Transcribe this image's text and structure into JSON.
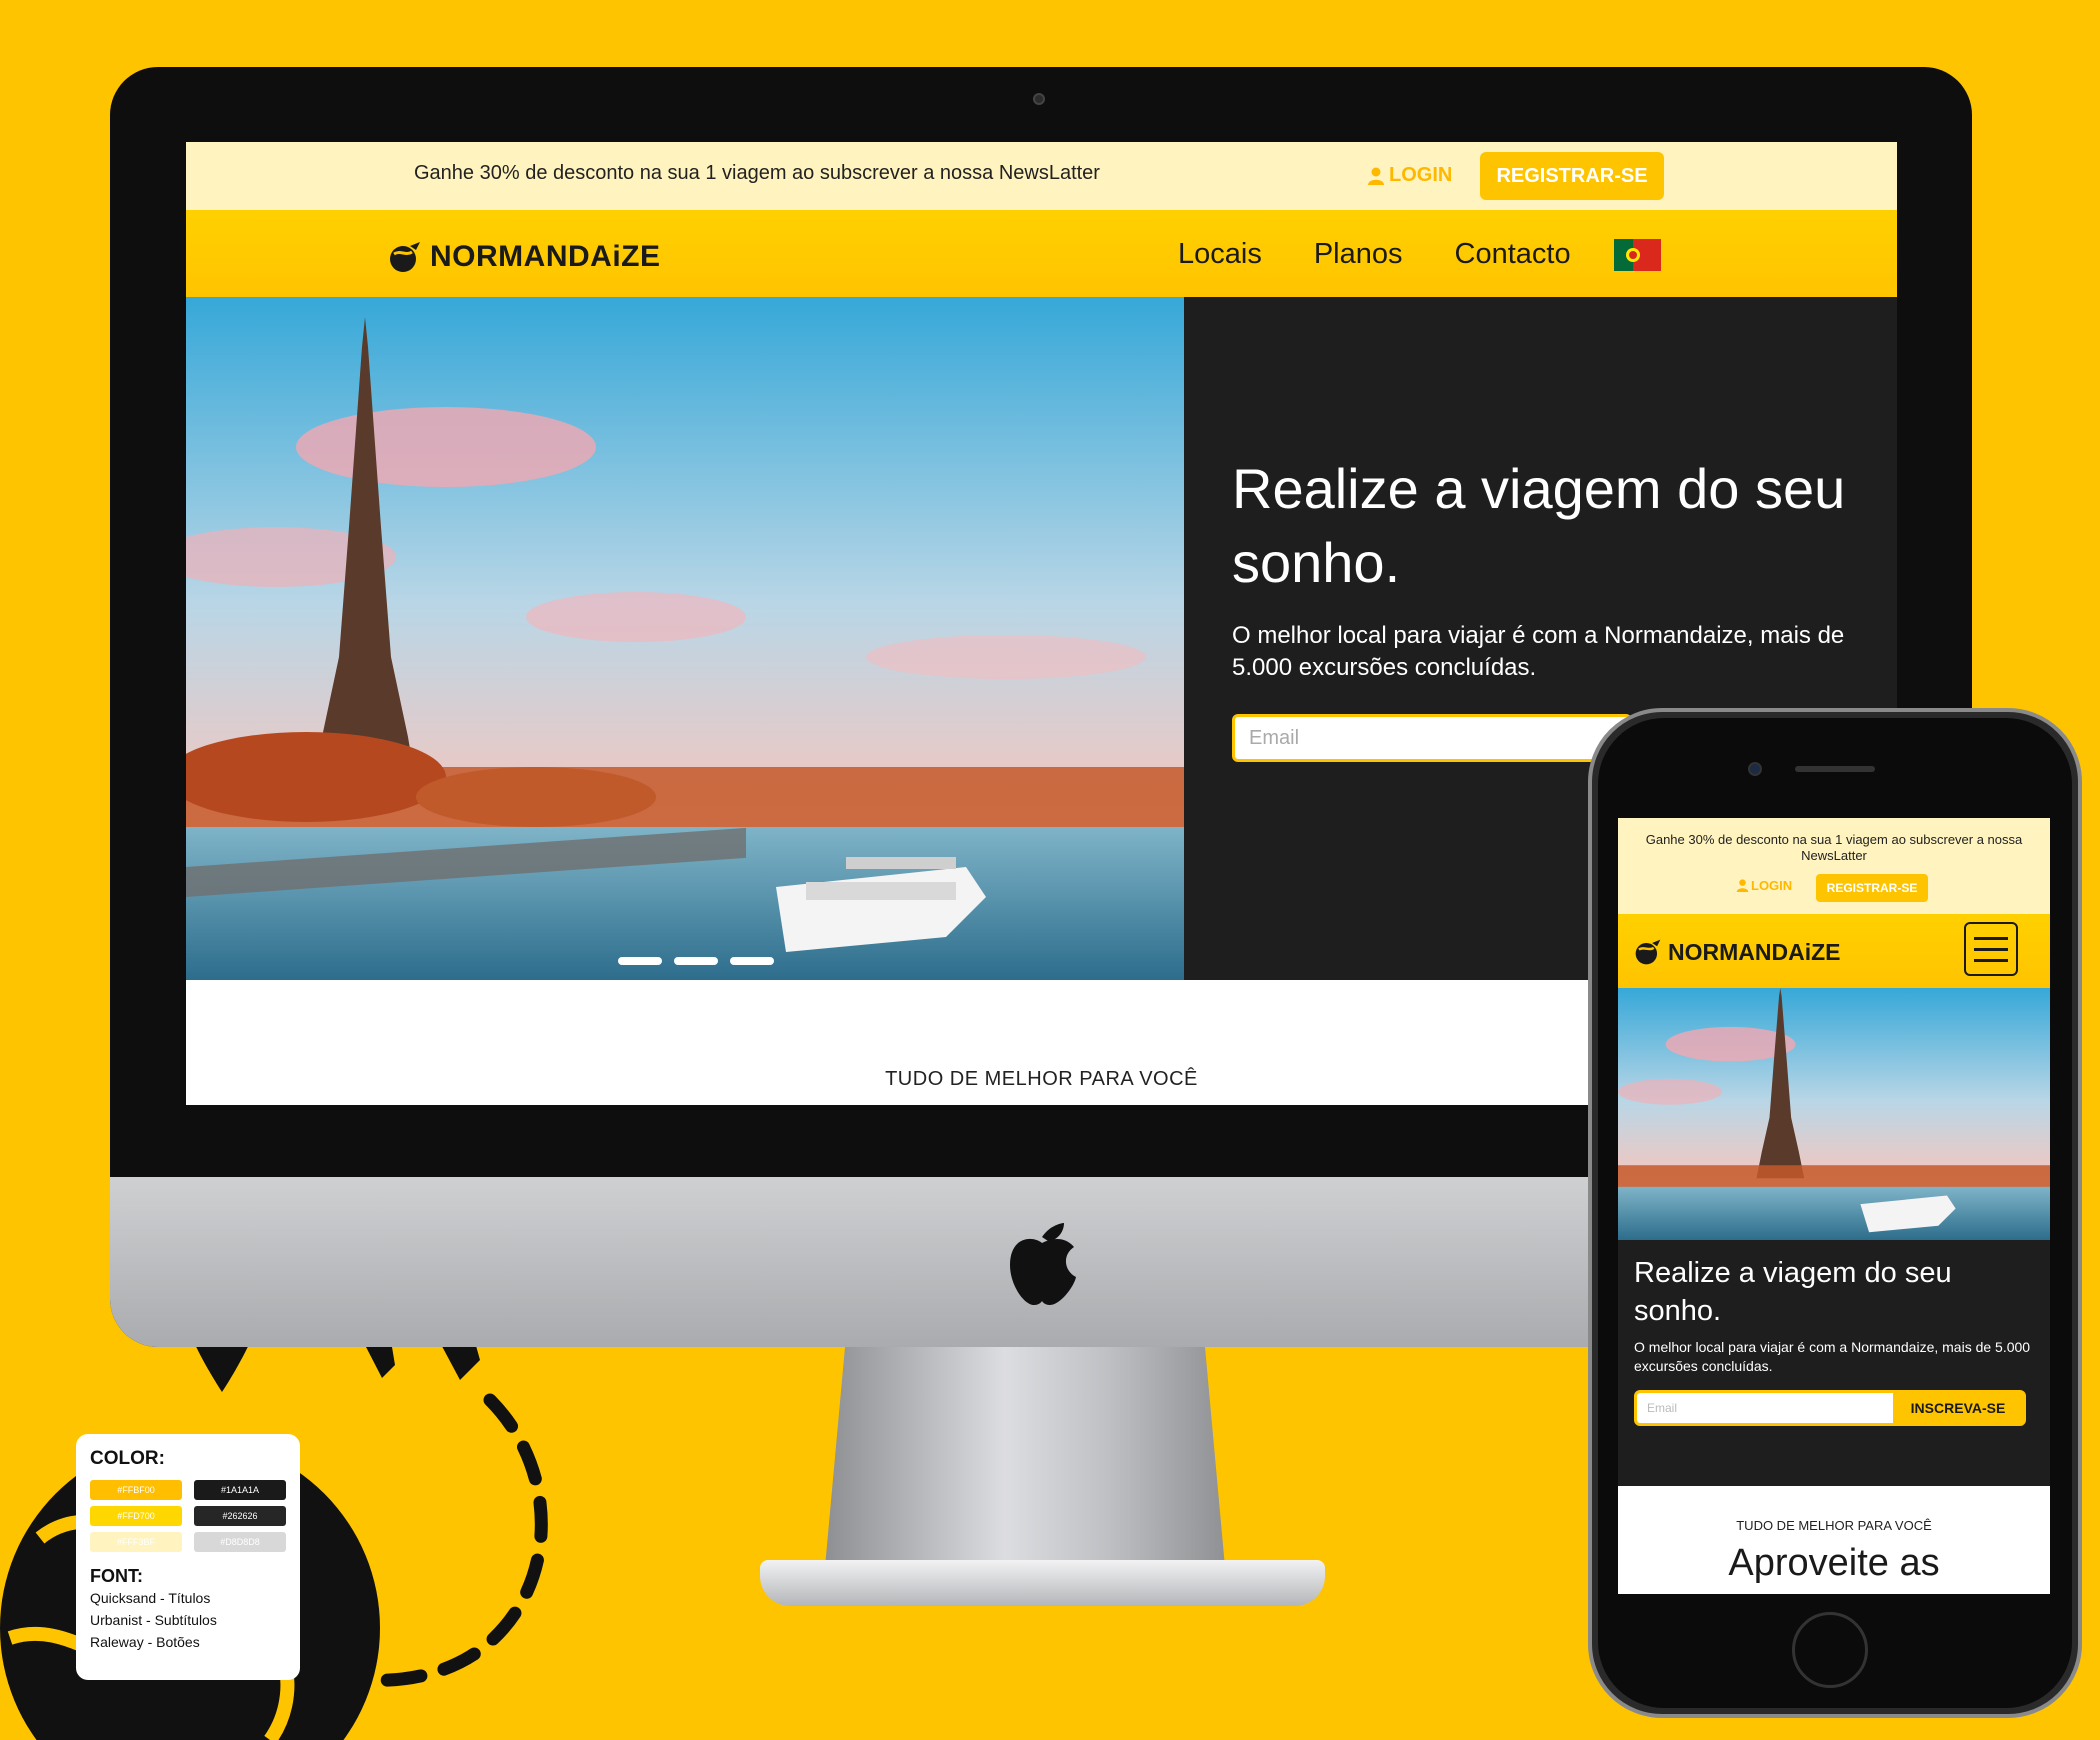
{
  "promo_text": "Ganhe 30% de desconto na sua 1 viagem ao subscrever a nossa NewsLatter",
  "auth": {
    "login_label": "LOGIN",
    "register_label": "REGISTRAR-SE"
  },
  "brand": {
    "name": "NORMANDAiZE"
  },
  "nav": {
    "links": [
      "Locais",
      "Planos",
      "Contacto"
    ]
  },
  "hero": {
    "title": "Realize a viagem do seu sonho.",
    "subtitle": "O melhor local para viajar é com a Normandaize, mais de 5.000 excursões concluídas.",
    "email_placeholder": "Email",
    "subscribe_label": "INSCREVA-SE",
    "slide_count": 3
  },
  "section": {
    "tagline": "TUDO DE MELHOR PARA VOCÊ",
    "heading": "Aproveite as"
  },
  "style_guide": {
    "color_heading": "COLOR:",
    "colors": [
      {
        "hex": "#FFBF00",
        "label": "#FFBF00"
      },
      {
        "hex": "#1A1A1A",
        "label": "#1A1A1A"
      },
      {
        "hex": "#FFD700",
        "label": "#FFD700"
      },
      {
        "hex": "#262626",
        "label": "#262626"
      },
      {
        "hex": "#FFF3BF",
        "label": "#FFF3BF"
      },
      {
        "hex": "#D8D8D8",
        "label": "#D8D8D8"
      }
    ],
    "font_heading": "FONT:",
    "fonts": [
      "Quicksand - Títulos",
      "Urbanist - Subtítulos",
      "Raleway - Botões"
    ]
  },
  "colors": {
    "accent": "#FFC400",
    "dark": "#1E1E1E",
    "light": "#FFF4BF"
  }
}
